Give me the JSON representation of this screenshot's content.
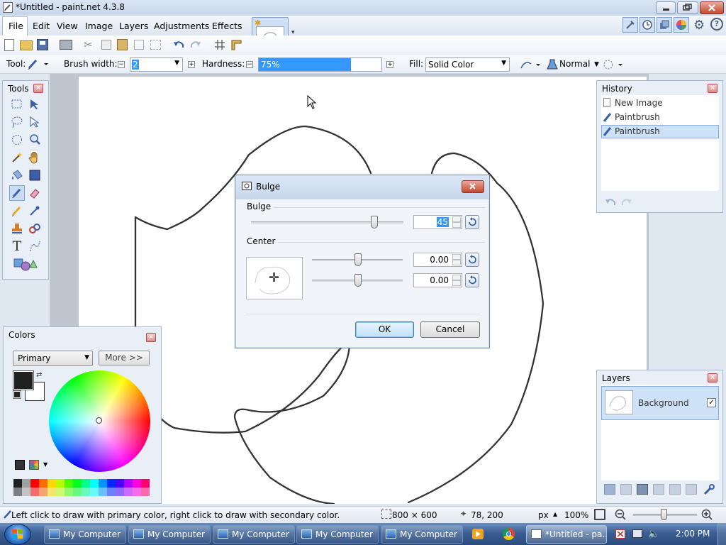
{
  "window": {
    "title": "*Untitled - paint.net 4.3.8"
  },
  "menu": [
    "File",
    "Edit",
    "View",
    "Image",
    "Layers",
    "Adjustments",
    "Effects"
  ],
  "settings": {
    "tool_label": "Tool:",
    "brush_width_label": "Brush width:",
    "brush_width_value": "2",
    "hardness_label": "Hardness:",
    "hardness_value": "75%",
    "hardness_fraction": 0.75,
    "fill_label": "Fill:",
    "fill_value": "Solid Color",
    "blend_mode": "Normal"
  },
  "tools_panel": {
    "title": "Tools"
  },
  "colors_panel": {
    "title": "Colors",
    "mode_select": "Primary",
    "more_button": "More >>",
    "palette": [
      "#202020",
      "#a0a0a0",
      "#ff0000",
      "#ff6a00",
      "#ffd800",
      "#b6ff00",
      "#4cff00",
      "#00ff21",
      "#00ff90",
      "#00ffff",
      "#0094ff",
      "#0026ff",
      "#4800ff",
      "#b200ff",
      "#ff00dc",
      "#ff006e"
    ]
  },
  "history_panel": {
    "title": "History",
    "items": [
      {
        "label": "New Image",
        "selected": false
      },
      {
        "label": "Paintbrush",
        "selected": false
      },
      {
        "label": "Paintbrush",
        "selected": true
      }
    ]
  },
  "layers_panel": {
    "title": "Layers",
    "layers": [
      {
        "name": "Background",
        "visible": true
      }
    ]
  },
  "dialog": {
    "title": "Bulge",
    "bulge_section": "Bulge",
    "bulge_value": "45",
    "center_section": "Center",
    "center_x": "0.00",
    "center_y": "0.00",
    "ok": "OK",
    "cancel": "Cancel"
  },
  "status": {
    "hint": "Left click to draw with primary color, right click to draw with secondary color.",
    "image_size": "800 × 600",
    "cursor_pos": "78, 200",
    "units": "px",
    "zoom": "100%"
  },
  "taskbar": {
    "items": [
      "My Computer",
      "My Computer",
      "My Computer",
      "My Computer",
      "My Computer",
      "*Untitled - pa..."
    ],
    "clock": "2:00 PM"
  }
}
